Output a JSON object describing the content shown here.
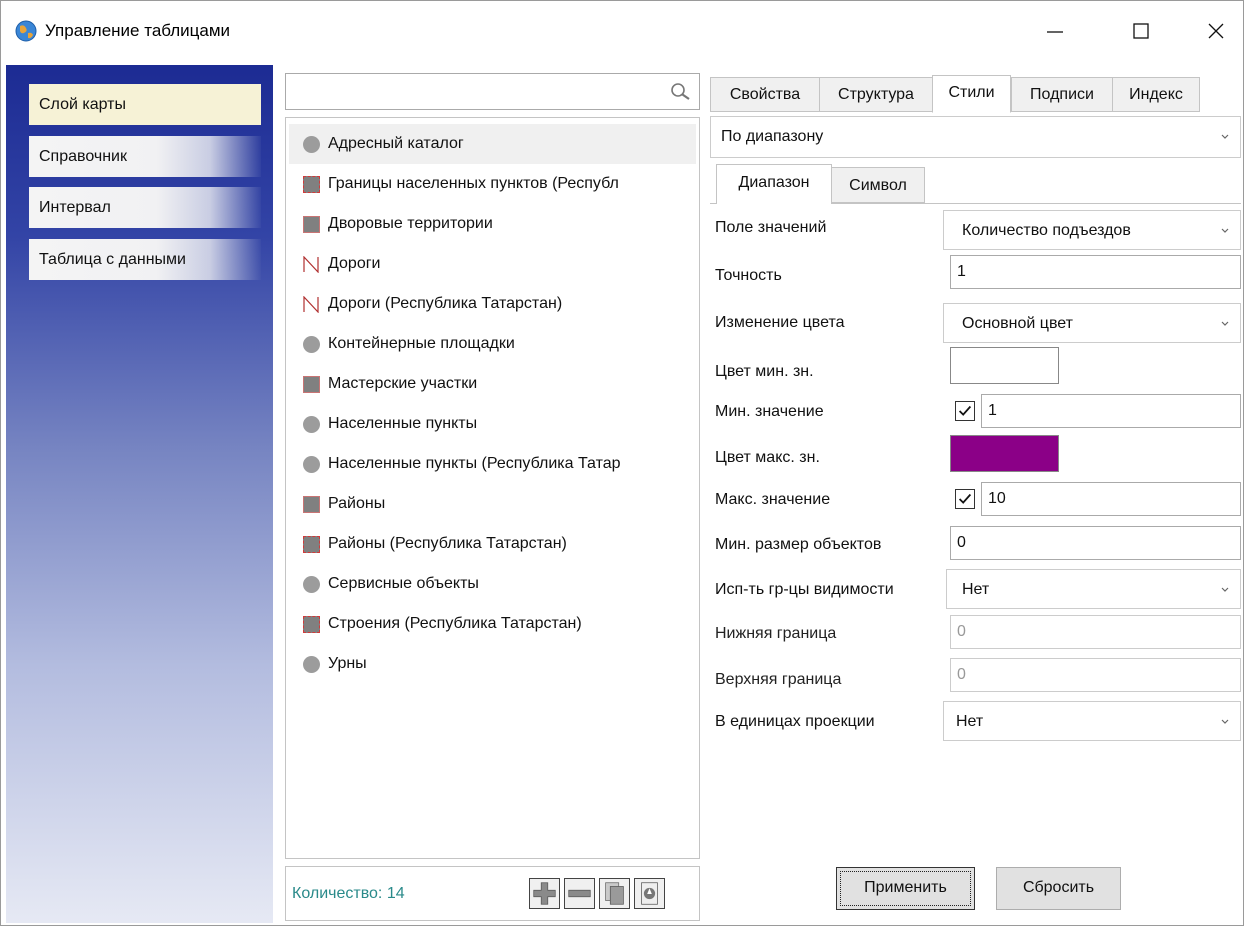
{
  "window": {
    "title": "Управление таблицами",
    "controls": [
      "minimize-icon",
      "maximize-icon",
      "close-icon"
    ]
  },
  "sidebar": {
    "items": [
      {
        "label": "Слой карты",
        "active": true
      },
      {
        "label": "Справочник",
        "active": false
      },
      {
        "label": "Интервал",
        "active": false
      },
      {
        "label": "Таблица с данными",
        "active": false
      }
    ]
  },
  "search": {
    "value": "",
    "icon": "search-icon"
  },
  "layers": [
    {
      "label": "Адресный каталог",
      "icon": "point-icon",
      "selected": true
    },
    {
      "label": "Границы населенных пунктов (Республ",
      "icon": "polygon-icon",
      "selected": false
    },
    {
      "label": "Дворовые территории",
      "icon": "polygon-icon",
      "selected": false
    },
    {
      "label": "Дороги",
      "icon": "line-icon",
      "selected": false
    },
    {
      "label": "Дороги (Республика Татарстан)",
      "icon": "line-icon",
      "selected": false
    },
    {
      "label": "Контейнерные площадки",
      "icon": "point-icon",
      "selected": false
    },
    {
      "label": "Мастерские участки",
      "icon": "polygon-icon",
      "selected": false
    },
    {
      "label": "Населенные пункты",
      "icon": "point-icon",
      "selected": false
    },
    {
      "label": "Населенные пункты (Республика Татар",
      "icon": "point-icon",
      "selected": false
    },
    {
      "label": "Районы",
      "icon": "polygon-icon",
      "selected": false
    },
    {
      "label": "Районы (Республика Татарстан)",
      "icon": "polygon-icon",
      "selected": false
    },
    {
      "label": "Сервисные объекты",
      "icon": "point-icon",
      "selected": false
    },
    {
      "label": "Строения (Республика Татарстан)",
      "icon": "polygon-icon",
      "selected": false
    },
    {
      "label": "Урны",
      "icon": "point-icon",
      "selected": false
    }
  ],
  "footer": {
    "count_label": "Количество: 14",
    "buttons": [
      "add-icon",
      "remove-icon",
      "copy-icon",
      "export-icon"
    ]
  },
  "tabs": [
    {
      "label": "Свойства",
      "active": false
    },
    {
      "label": "Структура",
      "active": false
    },
    {
      "label": "Стили",
      "active": true
    },
    {
      "label": "Подписи",
      "active": false
    },
    {
      "label": "Индекс",
      "active": false
    }
  ],
  "style_mode": "По диапазону",
  "subtabs": [
    {
      "label": "Диапазон",
      "active": true
    },
    {
      "label": "Символ",
      "active": false
    }
  ],
  "fields": {
    "value_field": {
      "label": "Поле значений",
      "value": "Количество подъездов"
    },
    "precision": {
      "label": "Точность",
      "value": "1"
    },
    "color_change": {
      "label": "Изменение цвета",
      "value": "Основной цвет"
    },
    "min_color": {
      "label": "Цвет мин. зн.",
      "color": "#ffffff"
    },
    "min_value": {
      "label": "Мин. значение",
      "checked": true,
      "value": "1"
    },
    "max_color": {
      "label": "Цвет макс. зн.",
      "color": "#8b0087"
    },
    "max_value": {
      "label": "Макс. значение",
      "checked": true,
      "value": "10"
    },
    "min_size": {
      "label": "Мин. размер объектов",
      "value": "0"
    },
    "use_visibility": {
      "label": "Исп-ть гр-цы видимости",
      "value": "Нет"
    },
    "lower_bound": {
      "label": "Нижняя граница",
      "value": "0"
    },
    "upper_bound": {
      "label": "Верхняя граница",
      "value": "0"
    },
    "projection_units": {
      "label": "В единицах проекции",
      "value": "Нет"
    }
  },
  "actions": {
    "apply": "Применить",
    "reset": "Сбросить"
  },
  "colors": {
    "accent_text": "#2a8a8a",
    "sidebar_active": "#f6f2d6",
    "sidebar_gradient_top": "#1c2b93"
  }
}
